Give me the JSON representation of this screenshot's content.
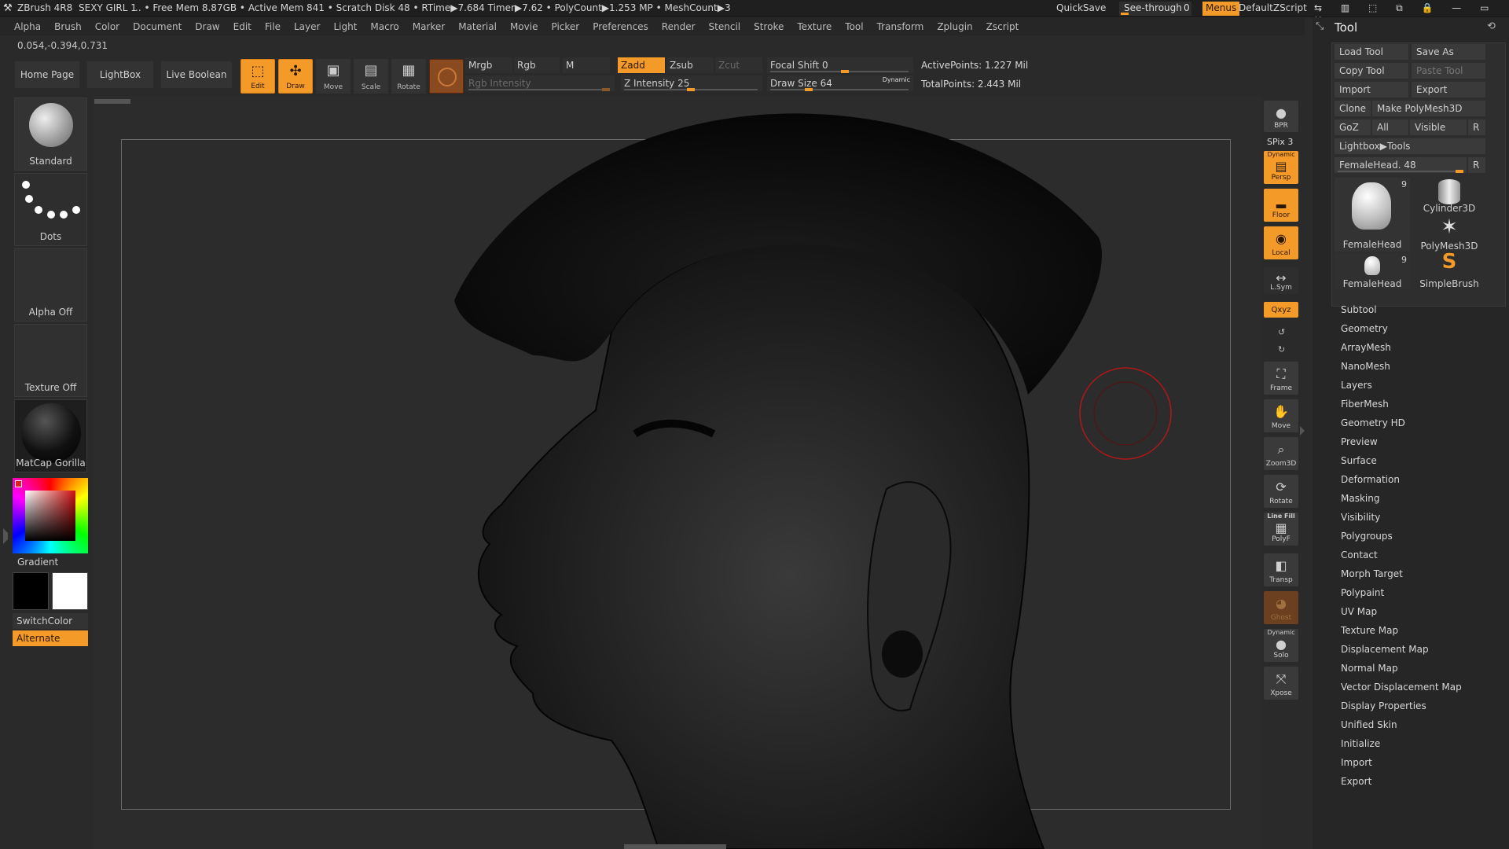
{
  "titlebar": {
    "app": "ZBrush 4R8",
    "doc": "SEXY GIRL 1",
    "stats": ".. • Free Mem 8.87GB • Active Mem 841 • Scratch Disk 48 •  RTime▶7.684 Timer▶7.62 • PolyCount▶1.253 MP  • MeshCount▶3",
    "quicksave": "QuickSave",
    "seethrough": "See-through",
    "seethrough_val": "0",
    "menus": "Menus",
    "script": "DefaultZScript"
  },
  "menubar": [
    "Alpha",
    "Brush",
    "Color",
    "Document",
    "Draw",
    "Edit",
    "File",
    "Layer",
    "Light",
    "Macro",
    "Marker",
    "Material",
    "Movie",
    "Picker",
    "Preferences",
    "Render",
    "Stencil",
    "Stroke",
    "Texture",
    "Tool",
    "Transform",
    "Zplugin",
    "Zscript"
  ],
  "coords": "0.054,-0.394,0.731",
  "toolbar": {
    "home": "Home Page",
    "lightbox": "LightBox",
    "liveboolean": "Live Boolean",
    "edit": "Edit",
    "draw": "Draw",
    "move": "Move",
    "scale": "Scale",
    "rotate": "Rotate",
    "mrgb": "Mrgb",
    "rgb": "Rgb",
    "m": "M",
    "rgb_intensity": "Rgb Intensity",
    "zadd": "Zadd",
    "zsub": "Zsub",
    "zcut": "Zcut",
    "z_intensity": "Z Intensity 25",
    "focal_shift": "Focal Shift 0",
    "draw_size": "Draw Size 64",
    "dynamic": "Dynamic",
    "active_points": "ActivePoints: 1.227 Mil",
    "total_points": "TotalPoints: 2.443 Mil"
  },
  "leftpanel": {
    "brush": "Standard",
    "stroke": "Dots",
    "alpha": "Alpha Off",
    "texture": "Texture Off",
    "material": "MatCap Gorilla",
    "gradient": "Gradient",
    "switchcolor": "SwitchColor",
    "alternate": "Alternate"
  },
  "rightstrip": {
    "bpr": "BPR",
    "spix": "SPix 3",
    "persp": "Persp",
    "persp_top": "Dynamic",
    "floor": "Floor",
    "local": "Local",
    "lsym": "L.Sym",
    "xyz": "Qxyz",
    "frame": "Frame",
    "move": "Move",
    "zoom3d": "Zoom3D",
    "rotate": "Rotate",
    "linefill": "Line Fill",
    "polyf": "PolyF",
    "transp": "Transp",
    "ghost": "Ghost",
    "dynamic": "Dynamic",
    "solo": "Solo",
    "xpose": "Xpose"
  },
  "toolpanel": {
    "title": "Tool",
    "load_tool": "Load Tool",
    "save_as": "Save As",
    "copy_tool": "Copy Tool",
    "paste_tool": "Paste Tool",
    "import": "Import",
    "export": "Export",
    "clone": "Clone",
    "make_polymesh": "Make PolyMesh3D",
    "goz": "GoZ",
    "all": "All",
    "visible": "Visible",
    "r": "R",
    "lightbox_tools": "Lightbox▶Tools",
    "current_tool": "FemaleHead. 48",
    "tools": [
      {
        "name": "FemaleHead",
        "count": "9"
      },
      {
        "name": "Cylinder3D",
        "count": ""
      },
      {
        "name": "PolyMesh3D",
        "count": ""
      },
      {
        "name": "FemaleHead",
        "count": "9"
      },
      {
        "name": "SimpleBrush",
        "count": ""
      }
    ],
    "menu": [
      "Subtool",
      "Geometry",
      "ArrayMesh",
      "NanoMesh",
      "Layers",
      "FiberMesh",
      "Geometry HD",
      "Preview",
      "Surface",
      "Deformation",
      "Masking",
      "Visibility",
      "Polygroups",
      "Contact",
      "Morph Target",
      "Polypaint",
      "UV Map",
      "Texture Map",
      "Displacement Map",
      "Normal Map",
      "Vector Displacement Map",
      "Display Properties",
      "Unified Skin",
      "Initialize",
      "Import",
      "Export"
    ]
  },
  "colors": {
    "accent": "#f39a28",
    "bg": "#2a2a2a",
    "cursor": "#b01818"
  }
}
